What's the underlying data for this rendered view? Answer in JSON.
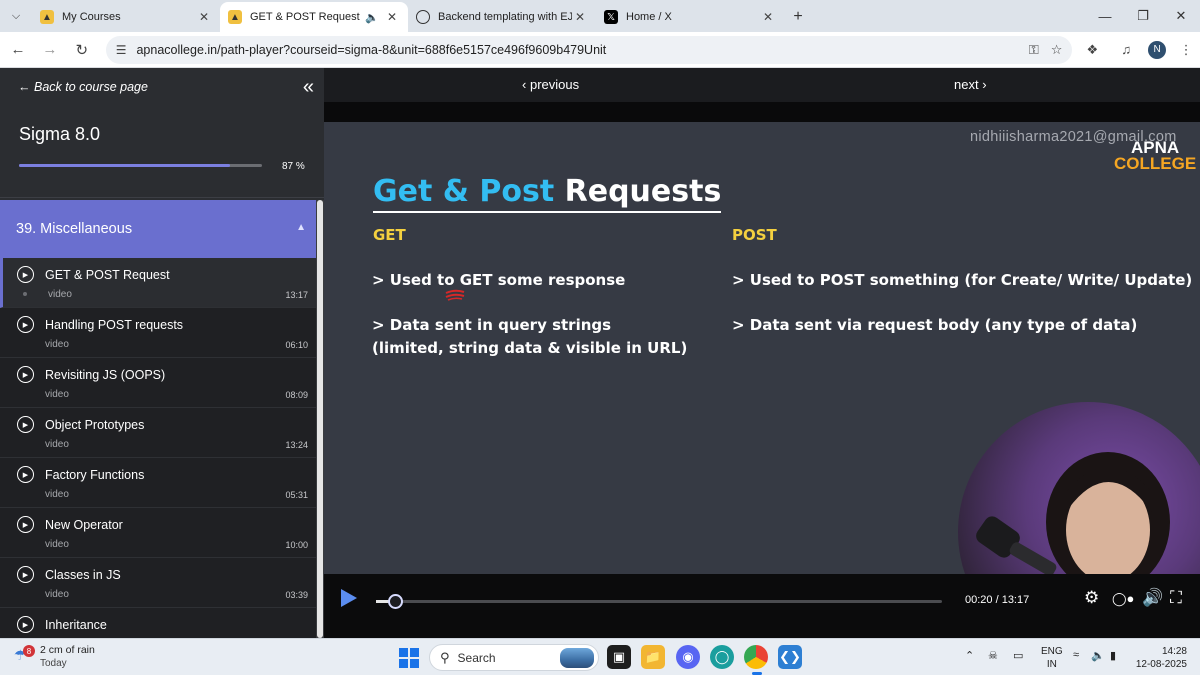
{
  "browser": {
    "tabs": [
      {
        "title": "My Courses",
        "active": false
      },
      {
        "title": "GET & POST Request",
        "active": true
      },
      {
        "title": "Backend templating with EJS",
        "active": false
      },
      {
        "title": "Home / X",
        "active": false
      }
    ],
    "url": "apnacollege.in/path-player?courseid=sigma-8&unit=688f6e5157ce496f9609b479Unit",
    "profile_initial": "N"
  },
  "sidebar": {
    "back_label": "Back to course page",
    "course_title": "Sigma 8.0",
    "progress_percent": 87,
    "progress_label": "87 %",
    "section_title": "39. Miscellaneous",
    "lessons": [
      {
        "title": "GET & POST Request",
        "type": "video",
        "duration": "13:17"
      },
      {
        "title": "Handling POST requests",
        "type": "video",
        "duration": "06:10"
      },
      {
        "title": "Revisiting JS (OOPS)",
        "type": "video",
        "duration": "08:09"
      },
      {
        "title": "Object Prototypes",
        "type": "video",
        "duration": "13:24"
      },
      {
        "title": "Factory Functions",
        "type": "video",
        "duration": "05:31"
      },
      {
        "title": "New Operator",
        "type": "video",
        "duration": "10:00"
      },
      {
        "title": "Classes in JS",
        "type": "video",
        "duration": "03:39"
      },
      {
        "title": "Inheritance",
        "type": "video",
        "duration": ""
      }
    ]
  },
  "player": {
    "prev_label": "previous",
    "next_label": "next",
    "watermark": "nidhiiisharma2021@gmail.com",
    "brand_line1": "APNA",
    "brand_line2": "COLLEGE",
    "slide": {
      "title_accent": "Get & Post",
      "title_rest": "Requests",
      "get_head": "GET",
      "post_head": "POST",
      "get_b1": "> Used to GET some response",
      "get_b2": "> Data sent in query strings",
      "get_b2b": "(limited, string data & visible in URL)",
      "post_b1": "> Used to POST something (for Create/ Write/ Update)",
      "post_b2": "> Data sent via request body (any type of data)"
    },
    "timecode": "00:20 / 13:17",
    "played_fraction": 0.025
  },
  "taskbar": {
    "weather_badge": "8",
    "weather_line1": "2 cm of rain",
    "weather_line2": "Today",
    "search_label": "Search",
    "lang_line1": "ENG",
    "lang_line2": "IN",
    "time": "14:28",
    "date": "12-08-2025"
  }
}
